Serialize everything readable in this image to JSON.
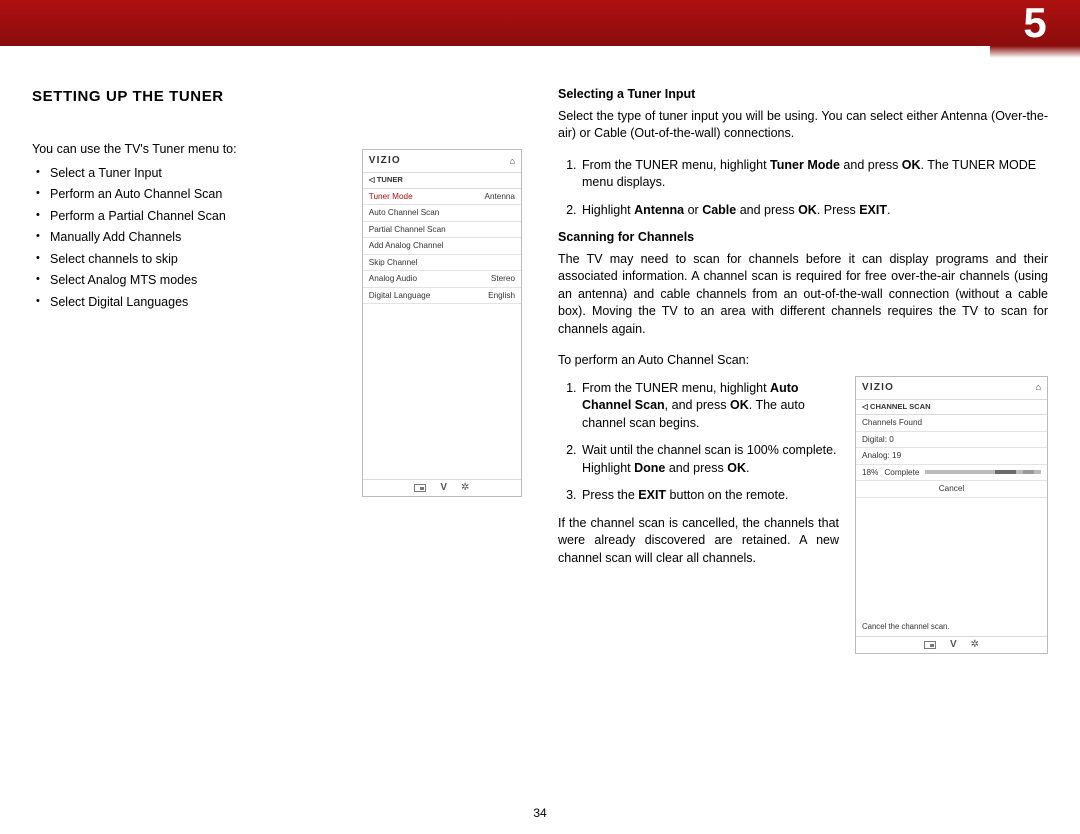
{
  "chapter_number": "5",
  "page_number": "34",
  "left": {
    "heading": "SETTING UP THE TUNER",
    "intro": "You can use the TV's Tuner menu to:",
    "bullets": [
      "Select a Tuner Input",
      "Perform an Auto Channel Scan",
      "Perform a Partial Channel Scan",
      "Manually Add Channels",
      "Select channels to skip",
      "Select Analog MTS modes",
      "Select Digital Languages"
    ]
  },
  "osd1": {
    "brand": "VIZIO",
    "home": "⌂",
    "crumb_back": "◁",
    "crumb": "TUNER",
    "rows": [
      {
        "k": "Tuner Mode",
        "v": "Antenna",
        "sel": true
      },
      {
        "k": "Auto Channel Scan",
        "v": ""
      },
      {
        "k": "Partial Channel Scan",
        "v": ""
      },
      {
        "k": "Add Analog Channel",
        "v": ""
      },
      {
        "k": "Skip Channel",
        "v": ""
      },
      {
        "k": "Analog Audio",
        "v": "Stereo"
      },
      {
        "k": "Digital Language",
        "v": "English"
      }
    ]
  },
  "right": {
    "h1": "Selecting a Tuner Input",
    "p1": "Select the type of tuner input you will be using. You can select either Antenna (Over-the-air) or Cable (Out-of-the-wall) connections.",
    "step1a": "From the TUNER menu, highlight ",
    "step1b": "Tuner Mode",
    "step1c": " and press ",
    "step1d": "OK",
    "step1e": ". The TUNER MODE menu displays.",
    "step2a": "Highlight ",
    "step2b": "Antenna",
    "step2c": " or ",
    "step2d": "Cable",
    "step2e": " and press ",
    "step2f": "OK",
    "step2g": ". Press ",
    "step2h": "EXIT",
    "step2i": ".",
    "h2": "Scanning for Channels",
    "p2": "The TV may need to scan for channels before it can display programs and their associated information. A channel scan is required for free over-the-air channels (using an antenna) and cable channels from an out-of-the-wall connection (without a cable box). Moving the TV to an area with different channels requires the TV to scan for channels again.",
    "p3": "To perform an Auto Channel Scan:",
    "l1a": "From the TUNER menu, highlight ",
    "l1b": "Auto Channel Scan",
    "l1c": ", and press ",
    "l1d": "OK",
    "l1e": ". The auto channel scan begins.",
    "l2a": "Wait until the channel scan is 100% complete. Highlight ",
    "l2b": "Done",
    "l2c": " and press ",
    "l2d": "OK",
    "l2e": ".",
    "l3a": "Press the ",
    "l3b": "EXIT",
    "l3c": " button on the remote.",
    "p4": "If the channel scan is cancelled, the channels that were already discovered are retained. A new channel scan will clear all channels."
  },
  "osd2": {
    "brand": "VIZIO",
    "home": "⌂",
    "crumb_back": "◁",
    "crumb": "CHANNEL SCAN",
    "row_found": "Channels Found",
    "row_digital": "Digital:   0",
    "row_analog": "Analog: 19",
    "pct": "18%",
    "complete": "Complete",
    "cancel": "Cancel",
    "status": "Cancel the channel scan."
  },
  "chart_data": {
    "type": "bar",
    "title": "Channel Scan Progress",
    "categories": [
      "Complete"
    ],
    "values": [
      18
    ],
    "ylim": [
      0,
      100
    ],
    "series_detail": {
      "digital_found": 0,
      "analog_found": 19
    }
  }
}
